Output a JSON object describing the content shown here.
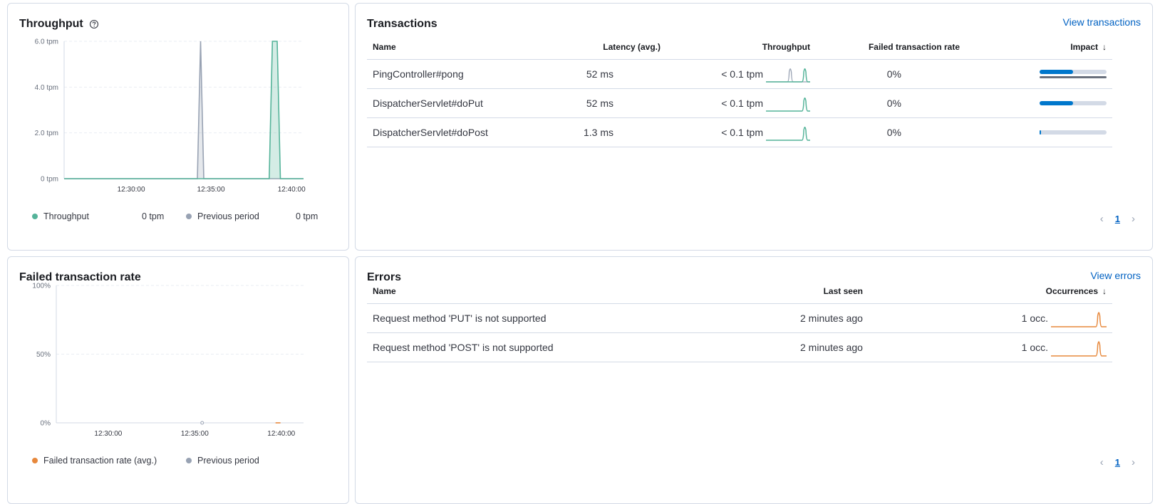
{
  "throughput_panel": {
    "title": "Throughput",
    "help_icon": "question-circle-icon",
    "legend": [
      {
        "label": "Throughput",
        "value": "0 tpm",
        "color": "#54b399"
      },
      {
        "label": "Previous period",
        "value": "0 tpm",
        "color": "#98a2b3"
      }
    ]
  },
  "failed_panel": {
    "title": "Failed transaction rate",
    "legend": [
      {
        "label": "Failed transaction rate (avg.)",
        "color": "#e7883c"
      },
      {
        "label": "Previous period",
        "color": "#98a2b3"
      }
    ]
  },
  "chart_data": [
    {
      "type": "line",
      "ylim": [
        0,
        6
      ],
      "yticks": [
        "0 tpm",
        "2.0 tpm",
        "4.0 tpm",
        "6.0 tpm"
      ],
      "xticks": [
        "12:30:00",
        "12:35:00",
        "12:40:00"
      ],
      "x_range_minutes": [
        0,
        15
      ],
      "series": [
        {
          "name": "Throughput",
          "color": "#54b399",
          "x": [
            0,
            12.85,
            13.05,
            13.35,
            13.55,
            15
          ],
          "y": [
            0,
            0,
            6,
            6,
            0,
            0
          ]
        },
        {
          "name": "Previous period",
          "color": "#98a2b3",
          "x": [
            0,
            8.35,
            8.55,
            8.75,
            15
          ],
          "y": [
            0,
            0,
            6,
            0,
            0
          ]
        }
      ]
    },
    {
      "type": "line",
      "ylim": [
        0,
        100
      ],
      "yticks": [
        "0%",
        "50%",
        "100%"
      ],
      "xticks": [
        "12:30:00",
        "12:35:00",
        "12:40:00"
      ],
      "x_range_minutes": [
        0,
        15
      ],
      "series": [
        {
          "name": "Failed transaction rate (avg.)",
          "color": "#e7883c",
          "x": [
            13.3,
            13.6
          ],
          "y": [
            0,
            0
          ]
        },
        {
          "name": "Previous period",
          "color": "#98a2b3",
          "x": [
            8.85
          ],
          "y": [
            0
          ]
        }
      ]
    }
  ],
  "transactions": {
    "title": "Transactions",
    "view_link": "View transactions",
    "columns": {
      "name": "Name",
      "latency": "Latency (avg.)",
      "throughput": "Throughput",
      "failed": "Failed transaction rate",
      "impact": "Impact"
    },
    "rows": [
      {
        "name": "PingController#pong",
        "latency": "52 ms",
        "throughput": "< 0.1 tpm",
        "failed": "0%",
        "impact": 0.5,
        "impact_prev": true,
        "spark_prev": true
      },
      {
        "name": "DispatcherServlet#doPut",
        "latency": "52 ms",
        "throughput": "< 0.1 tpm",
        "failed": "0%",
        "impact": 0.5,
        "impact_prev": false,
        "spark_prev": false
      },
      {
        "name": "DispatcherServlet#doPost",
        "latency": "1.3 ms",
        "throughput": "< 0.1 tpm",
        "failed": "0%",
        "impact": 0.02,
        "impact_prev": false,
        "spark_prev": false
      }
    ],
    "pagination": {
      "page": "1"
    }
  },
  "errors": {
    "title": "Errors",
    "view_link": "View errors",
    "columns": {
      "name": "Name",
      "last_seen": "Last seen",
      "occurrences": "Occurrences"
    },
    "rows": [
      {
        "name": "Request method 'PUT' is not supported",
        "last_seen": "2 minutes ago",
        "occurrences": "1 occ."
      },
      {
        "name": "Request method 'POST' is not supported",
        "last_seen": "2 minutes ago",
        "occurrences": "1 occ."
      }
    ],
    "pagination": {
      "page": "1"
    }
  },
  "colors": {
    "link": "#0061c2",
    "impact": "#0077cc",
    "spark_green": "#54b399",
    "spark_orange": "#e7883c",
    "spark_prev": "#98a2b3"
  }
}
